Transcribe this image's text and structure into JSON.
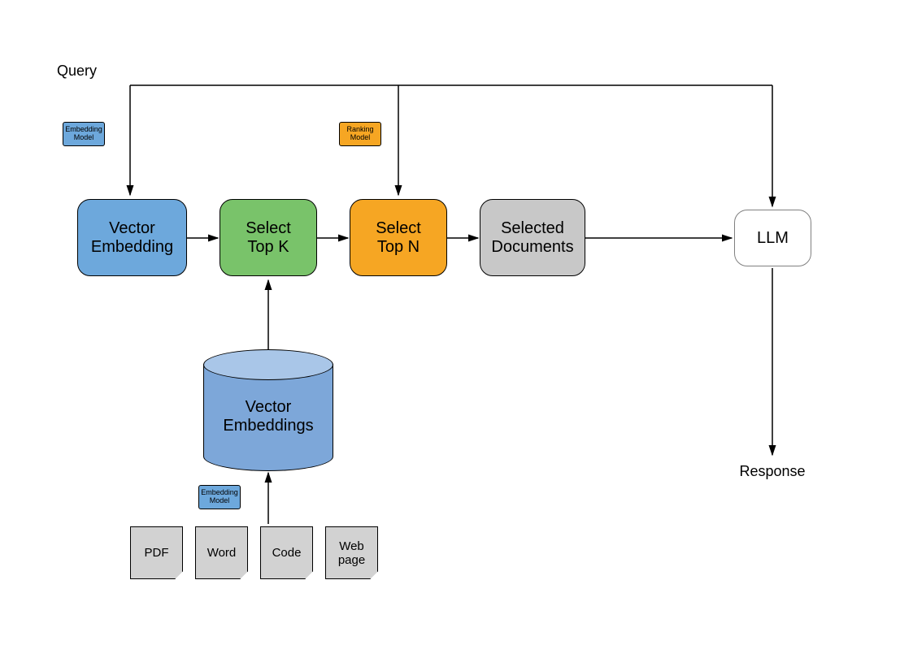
{
  "nodes": {
    "query": "Query",
    "vector_embedding": "Vector\nEmbedding",
    "select_top_k": "Select\nTop K",
    "select_top_n": "Select\nTop N",
    "selected_docs": "Selected\nDocuments",
    "llm": "LLM",
    "response": "Response",
    "vector_db": "Vector\nEmbeddings"
  },
  "tags": {
    "embedding_model_1": "Embedding\nModel",
    "ranking_model": "Ranking\nModel",
    "embedding_model_2": "Embedding\nModel"
  },
  "docs": {
    "pdf": "PDF",
    "word": "Word",
    "code": "Code",
    "web": "Web\npage"
  },
  "colors": {
    "blue": "#6da8dc",
    "blue_light": "#7da7d9",
    "blue_cap": "#a9c6e8",
    "green": "#79c36a",
    "orange": "#f6a623",
    "orange_tag": "#f6a623",
    "grey": "#c8c8c8",
    "grey_light": "#d2d2d2"
  }
}
